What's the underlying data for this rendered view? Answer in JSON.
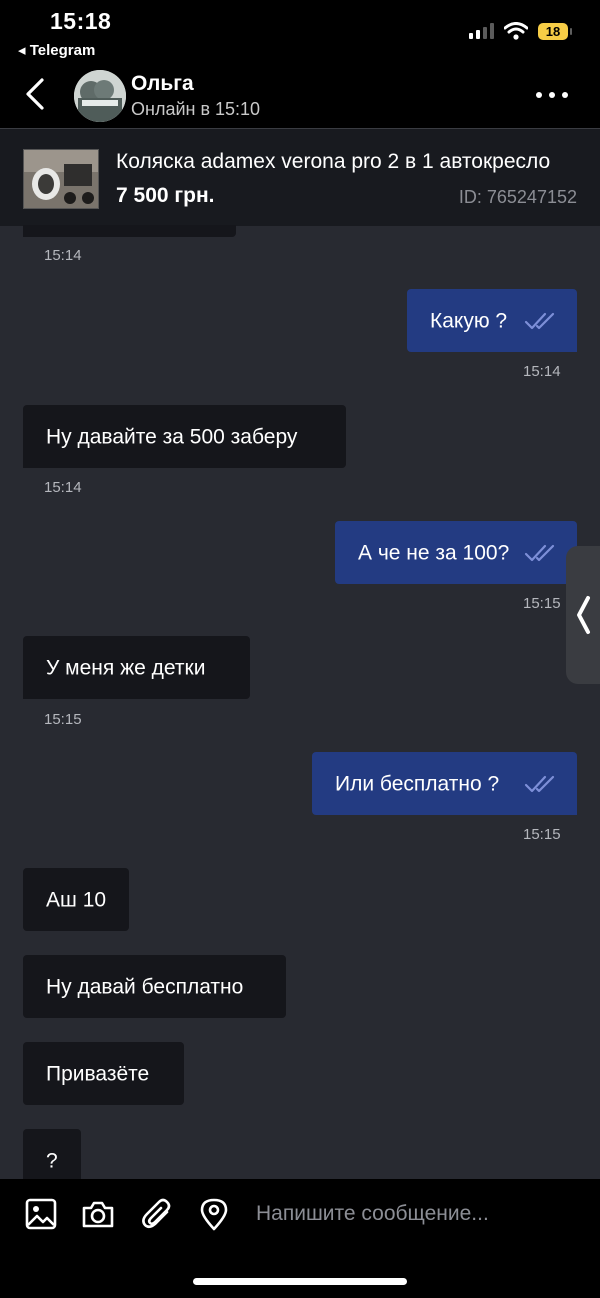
{
  "status_bar": {
    "time": "15:18",
    "back_app": "◂ Telegram",
    "battery": "18"
  },
  "header": {
    "contact_name": "Ольга",
    "status": "Онлайн в 15:10"
  },
  "listing": {
    "title": "Коляска adamex verona pro 2 в 1 автокресло",
    "price": "7 500 грн.",
    "id": "ID: 765247152"
  },
  "messages": [
    {
      "text": "",
      "time": "15:14"
    },
    {
      "text": "Какую ?",
      "time": "15:14"
    },
    {
      "text": "Ну давайте за 500 заберу",
      "time": "15:14"
    },
    {
      "text": "А че не за 100?",
      "time": "15:15"
    },
    {
      "text": "У меня же детки",
      "time": "15:15"
    },
    {
      "text": "Или бесплатно ?",
      "time": "15:15"
    },
    {
      "text": "Аш 10"
    },
    {
      "text": "Ну давай бесплатно"
    },
    {
      "text": "Привазёте"
    },
    {
      "text": "?"
    }
  ],
  "composer": {
    "placeholder": "Напишите сообщение..."
  },
  "icons": [
    "chevron-left-icon",
    "more-icon",
    "image-icon",
    "camera-icon",
    "paperclip-icon",
    "location-icon",
    "double-check-icon",
    "wifi-icon",
    "signal-icon"
  ],
  "colors": {
    "outgoing_bubble": "#233b82",
    "incoming_bubble": "#15161b",
    "chat_bg": "#282a31",
    "check": "#7d8fd8"
  }
}
